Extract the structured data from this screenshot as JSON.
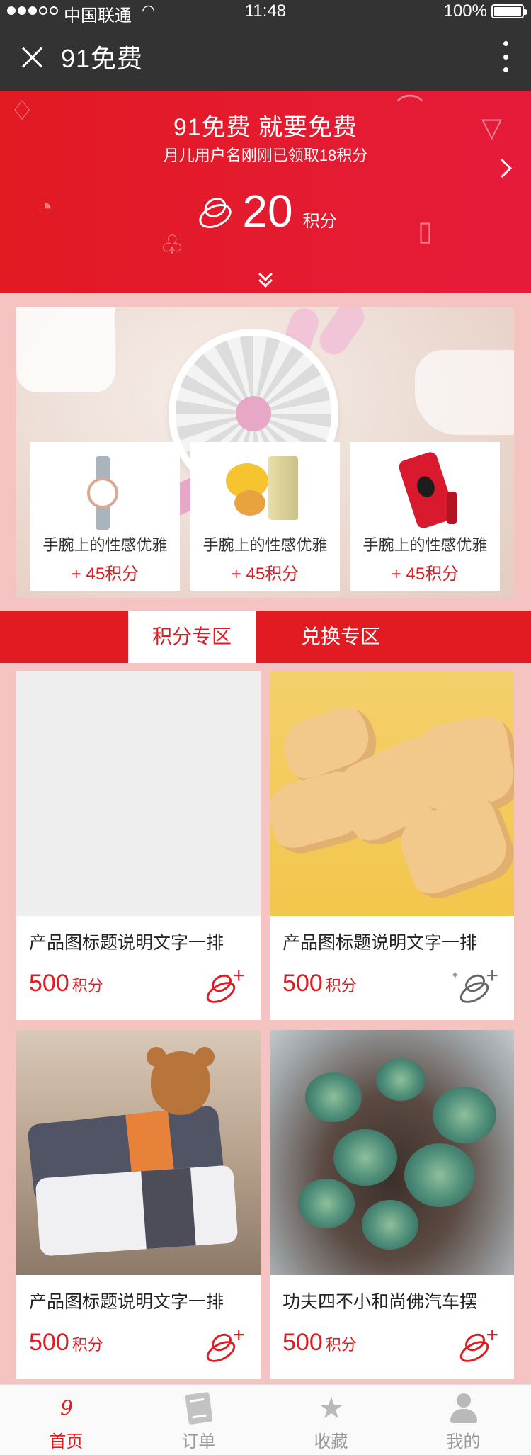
{
  "status_bar": {
    "carrier": "中国联通",
    "time": "11:48",
    "battery": "100%"
  },
  "nav": {
    "title": "91免费"
  },
  "hero": {
    "title": "91免费  就要免费",
    "subtitle": "月儿用户名刚刚已领取18积分",
    "points_value": "20",
    "points_unit": "积分"
  },
  "banner": {
    "items": [
      {
        "name": "手腕上的性感优雅",
        "points": "+ 45积分",
        "icon": "watch"
      },
      {
        "name": "手腕上的性感优雅",
        "points": "+ 45积分",
        "icon": "tea"
      },
      {
        "name": "手腕上的性感优雅",
        "points": "+ 45积分",
        "icon": "phone-case"
      }
    ]
  },
  "tabs": {
    "points_zone": "积分专区",
    "exchange_zone": "兑换专区"
  },
  "products": [
    {
      "title": "产品图标题说明文字一排",
      "price": "500",
      "unit": "积分",
      "image": "blank"
    },
    {
      "title": "产品图标题说明文字一排",
      "price": "500",
      "unit": "积分",
      "image": "cookies"
    },
    {
      "title": "产品图标题说明文字一排",
      "price": "500",
      "unit": "积分",
      "image": "teddy-bear-pillows"
    },
    {
      "title": "功夫四不小和尚佛汽车摆",
      "price": "500",
      "unit": "积分",
      "image": "succulents"
    }
  ],
  "bottom_nav": {
    "items": [
      {
        "label": "首页",
        "icon": "home-logo-icon",
        "active": true
      },
      {
        "label": "订单",
        "icon": "order-icon",
        "active": false
      },
      {
        "label": "收藏",
        "icon": "favorite-icon",
        "active": false
      },
      {
        "label": "我的",
        "icon": "profile-icon",
        "active": false
      }
    ]
  },
  "colors": {
    "brand_red": "#e21a22",
    "page_bg": "#f6c3c3",
    "topbar": "#333333"
  }
}
